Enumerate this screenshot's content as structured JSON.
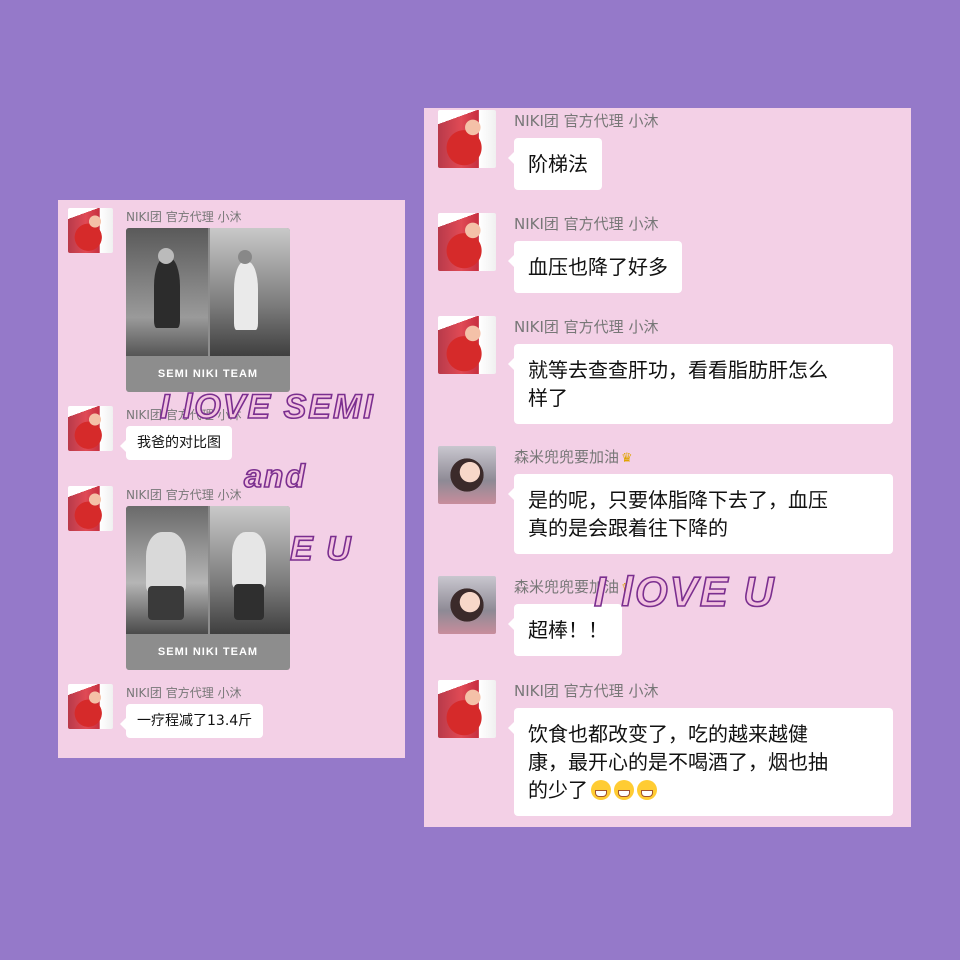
{
  "left_panel": {
    "messages": [
      {
        "type": "image",
        "sender": "NIKI团  官方代理 小沐",
        "caption": "SEMI  NIKI TEAM"
      },
      {
        "type": "text",
        "sender": "NIKI团  官方代理 小沐",
        "text": "我爸的对比图"
      },
      {
        "type": "image",
        "sender": "NIKI团  官方代理 小沐",
        "caption": "SEMI  NIKI TEAM"
      },
      {
        "type": "text",
        "sender": "NIKI团  官方代理 小沐",
        "text": "一疗程减了13.4斤"
      }
    ]
  },
  "right_panel": {
    "messages": [
      {
        "sender": "NIKI团  官方代理 小沐",
        "lines": [
          "阶梯法"
        ]
      },
      {
        "sender": "NIKI团  官方代理 小沐",
        "lines": [
          "血压也降了好多"
        ]
      },
      {
        "sender": "NIKI团  官方代理 小沐",
        "lines": [
          "就等去查查肝功，看看脂肪肝怎么",
          "样了"
        ]
      },
      {
        "sender": "森米兜兜要加油",
        "lines": [
          "是的呢，只要体脂降下去了，血压",
          "真的是会跟着往下降的"
        ]
      },
      {
        "sender": "森米兜兜要加油",
        "lines": [
          "超棒！！"
        ]
      },
      {
        "sender": "NIKI团  官方代理 小沐",
        "lines": [
          "饮食也都改变了，吃的越来越健",
          "康，最开心的是不喝酒了，烟也抽",
          "的少了"
        ]
      }
    ]
  },
  "overlays": {
    "line1": "I lOVE  SEMI",
    "line2": "and",
    "line3": "E  U",
    "line4": "I lOVE  U"
  },
  "icons": {
    "crown": "crown-icon",
    "grin": "grinning-face-icon"
  },
  "colors": {
    "background": "#9579c9",
    "panel": "#f3d0e6",
    "bubble": "#ffffff",
    "overlay_fill": "#f3c4e0",
    "overlay_stroke": "#7a2e8f"
  }
}
